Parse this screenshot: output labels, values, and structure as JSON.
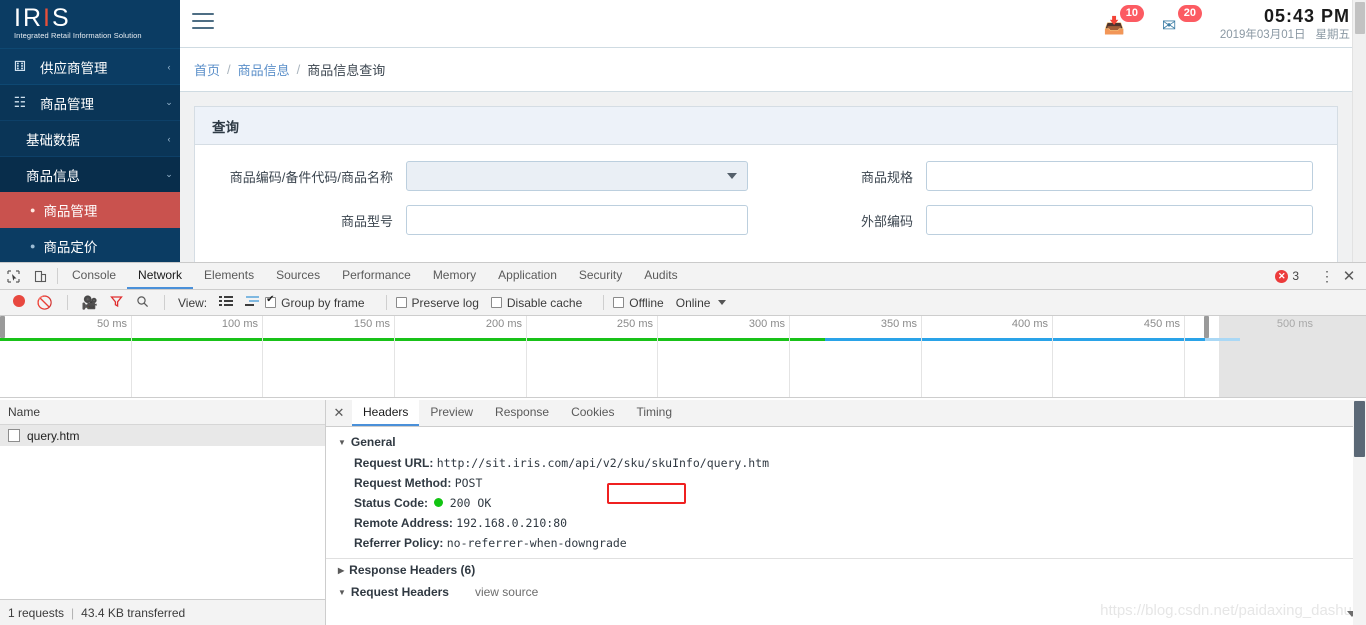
{
  "brand": {
    "name": "IRIS",
    "tagline": "Integrated Retail Information Solution"
  },
  "sidebar": {
    "items": [
      {
        "label": "供应商管理",
        "icon": "refresh-icon",
        "caret": "‹",
        "level": 1
      },
      {
        "label": "商品管理",
        "icon": "grid-icon",
        "caret": "⌄",
        "level": 1
      },
      {
        "label": "基础数据",
        "icon": "",
        "caret": "‹",
        "level": 2
      },
      {
        "label": "商品信息",
        "icon": "",
        "caret": "⌄",
        "level": 2
      },
      {
        "label": "商品管理",
        "icon": "",
        "caret": "",
        "level": 3,
        "active": true
      },
      {
        "label": "商品定价",
        "icon": "",
        "caret": "",
        "level": 3,
        "active": false
      }
    ]
  },
  "topbar": {
    "menu_toggle": "hamburger-icon",
    "notifications": [
      {
        "icon": "inbox-icon",
        "count": "10"
      },
      {
        "icon": "envelope-icon",
        "count": "20"
      }
    ],
    "time": "05:43 PM",
    "date": "2019年03月01日",
    "weekday": "星期五"
  },
  "breadcrumb": {
    "home": "首页",
    "parent": "商品信息",
    "current": "商品信息查询",
    "separator": "/"
  },
  "query_card": {
    "title": "查询",
    "fields": [
      {
        "label": "商品编码/备件代码/商品名称",
        "type": "select",
        "value": "",
        "name": "product-code-select"
      },
      {
        "label": "商品规格",
        "type": "input",
        "value": "",
        "name": "product-spec-input"
      },
      {
        "label": "商品型号",
        "type": "input",
        "value": "",
        "name": "product-model-input"
      },
      {
        "label": "外部编码",
        "type": "input",
        "value": "",
        "name": "external-code-input"
      }
    ]
  },
  "devtools": {
    "tabs": [
      {
        "label": "Console",
        "selected": false
      },
      {
        "label": "Network",
        "selected": true
      },
      {
        "label": "Elements",
        "selected": false
      },
      {
        "label": "Sources",
        "selected": false
      },
      {
        "label": "Performance",
        "selected": false
      },
      {
        "label": "Memory",
        "selected": false
      },
      {
        "label": "Application",
        "selected": false
      },
      {
        "label": "Security",
        "selected": false
      },
      {
        "label": "Audits",
        "selected": false
      }
    ],
    "error_count": "3",
    "toolbar": {
      "record_icon": "record-icon",
      "clear_icon": "clear-icon",
      "camera_icon": "camera-icon",
      "filter_icon": "filter-icon",
      "search_icon": "search-icon",
      "view_label": "View:",
      "list_icon": "list-view-icon",
      "waterfall_icon": "waterfall-view-icon",
      "group_by_frame": "Group by frame",
      "preserve_log": "Preserve log",
      "disable_cache": "Disable cache",
      "offline": "Offline",
      "throttling": "Online"
    },
    "timeline": {
      "ticks": [
        "50 ms",
        "100 ms",
        "150 ms",
        "200 ms",
        "250 ms",
        "300 ms",
        "350 ms",
        "400 ms",
        "450 ms",
        "500 ms"
      ]
    },
    "requests": {
      "column_header": "Name",
      "rows": [
        {
          "name": "query.htm",
          "selected": true
        }
      ]
    },
    "status": {
      "requests": "1 requests",
      "separator": "|",
      "transferred": "43.4 KB transferred"
    },
    "detail_tabs": [
      {
        "label": "Headers",
        "selected": true
      },
      {
        "label": "Preview",
        "selected": false
      },
      {
        "label": "Response",
        "selected": false
      },
      {
        "label": "Cookies",
        "selected": false
      },
      {
        "label": "Timing",
        "selected": false
      }
    ],
    "general": {
      "section_title": "General",
      "request_url_key": "Request URL:",
      "request_url_prefix": "http://sit.iris.com/api/v2/",
      "request_url_highlight": "sku/skuInfo",
      "request_url_suffix": "/query.htm",
      "request_method_key": "Request Method:",
      "request_method": "POST",
      "status_code_key": "Status Code:",
      "status_code": "200 OK",
      "remote_address_key": "Remote Address:",
      "remote_address": "192.168.0.210:80",
      "referrer_policy_key": "Referrer Policy:",
      "referrer_policy": "no-referrer-when-downgrade"
    },
    "response_headers": {
      "title": "Response Headers (6)"
    },
    "request_headers": {
      "title": "Request Headers",
      "view_source": "view source"
    }
  },
  "watermark": "https://blog.csdn.net/paidaxing_dashu"
}
